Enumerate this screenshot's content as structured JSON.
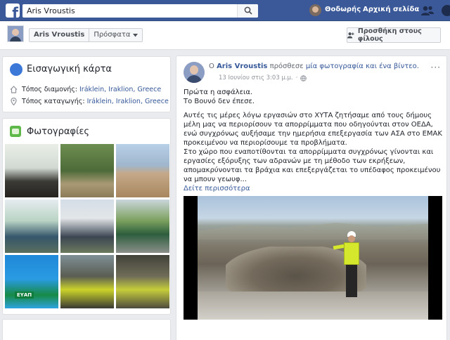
{
  "topbar": {
    "search_value": "Aris Vroustis",
    "user_name": "Θοδωρής",
    "home_label": "Αρχική σελίδα"
  },
  "profile_header": {
    "name": "Aris Vroustis",
    "recent_label": "Πρόσφατα",
    "add_friend_label": "Προσθήκη στους φίλους"
  },
  "intro": {
    "title": "Εισαγωγική κάρτα",
    "lives_label": "Τόπος διαμονής:",
    "lives_value": "Iráklein, Iraklion, Greece",
    "from_label": "Τόπος καταγωγής:",
    "from_value": "Iráklein, Iraklion, Greece"
  },
  "photos": {
    "title": "Φωτογραφίες",
    "tile_label": "ΕΥΑΠ"
  },
  "post": {
    "author": "Aris Vroustis",
    "prefix": "Ο",
    "action": "πρόσθεσε",
    "action_link": "μία φωτογραφία και ένα βίντεο.",
    "time": "13 Ιουνίου στις 3:03 μ.μ.",
    "time_suffix": "·",
    "more": "···",
    "line1": "Πρώτα η ασφάλεια.",
    "line2": "Το Βουνό δεν έπεσε.",
    "para1": "Αυτές τις μέρες λόγω εργασιών στο ΧΥΤΑ ζητήσαμε από τους δήμους μέλη μας να περιορίσουν τα απορρίμματα που οδηγούνται στον ΟΕΔΑ, ενώ συγχρόνως αυξήσαμε την ημερήσια επεξεργασία των ΑΣΑ στο ΕΜΑΚ προκειμένου να περιορίσουμε τα προβλήματα.",
    "para2": "Στο χώρο που εναποτίθονται τα απορρίμματα συγχρόνως γίνονται και εργασίες εξόρυξης των αδρανών με τη μέθοδο των εκρήξεων, απομακρύνονται τα βράχια και επεξεργάζεται το υπέδαφος προκειμένου να μπουν γεωυφ...",
    "see_more": "Δείτε περισσότερα"
  }
}
